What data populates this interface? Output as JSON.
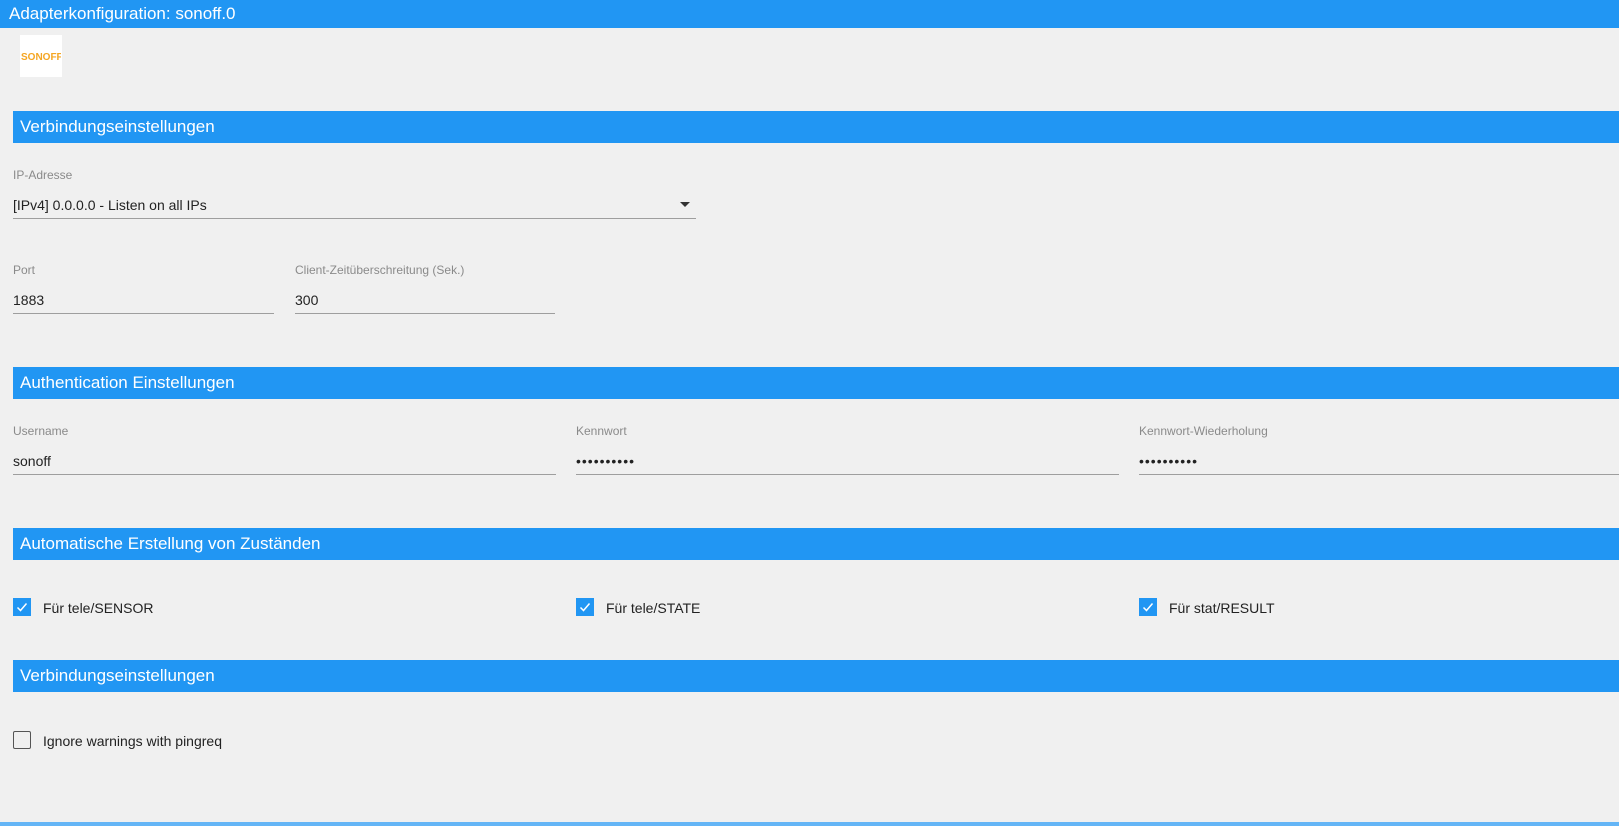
{
  "window": {
    "title": "Adapterkonfiguration: sonoff.0"
  },
  "logo": {
    "text": "SONOFF",
    "color": "#f5a623"
  },
  "colors": {
    "accent": "#2196f3",
    "background": "#f0f0f0"
  },
  "sections": {
    "connection": {
      "title": "Verbindungseinstellungen"
    },
    "auth": {
      "title": "Authentication Einstellungen"
    },
    "states": {
      "title": "Automatische Erstellung von Zuständen"
    },
    "connection2": {
      "title": "Verbindungseinstellungen"
    }
  },
  "fields": {
    "ip": {
      "label": "IP-Adresse",
      "value": "[IPv4] 0.0.0.0 - Listen on all IPs"
    },
    "port": {
      "label": "Port",
      "value": "1883"
    },
    "timeout": {
      "label": "Client-Zeitüberschreitung (Sek.)",
      "value": "300"
    },
    "username": {
      "label": "Username",
      "value": "sonoff"
    },
    "password": {
      "label": "Kennwort",
      "value": "••••••••••"
    },
    "password_repeat": {
      "label": "Kennwort-Wiederholung",
      "value": "••••••••••"
    }
  },
  "checkboxes": {
    "tele_sensor": {
      "label": "Für tele/SENSOR",
      "checked": true
    },
    "tele_state": {
      "label": "Für tele/STATE",
      "checked": true
    },
    "stat_result": {
      "label": "Für stat/RESULT",
      "checked": true
    },
    "ignore_pingreq": {
      "label": "Ignore warnings with pingreq",
      "checked": false
    }
  }
}
